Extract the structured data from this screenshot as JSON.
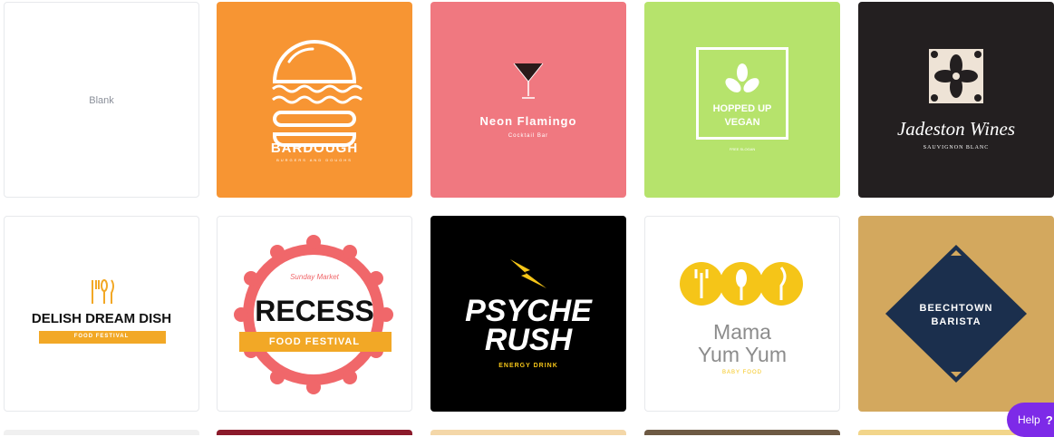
{
  "templates": {
    "blank": {
      "label": "Blank"
    },
    "bardough": {
      "title": "BARDOUGH",
      "subtitle": "BURGERS AND DOUGHS",
      "bg": "#f79533"
    },
    "neon_flamingo": {
      "title": "Neon Flamingo",
      "subtitle": "Cocktail Bar",
      "bg": "#f07880"
    },
    "hopped_up_vegan": {
      "title_line1": "HOPPED UP",
      "title_line2": "VEGAN",
      "subtitle": "FREE SLOGAN",
      "bg": "#b6e36c"
    },
    "jadeston_wines": {
      "title": "Jadeston Wines",
      "subtitle": "SAUVIGNON BLANC",
      "bg": "#231f20"
    },
    "delish": {
      "title": "DELISH DREAM DISH",
      "subtitle": "FOOD FESTIVAL",
      "accent": "#f2a826"
    },
    "recess": {
      "kicker": "Sunday Market",
      "title": "RECESS",
      "subtitle": "FOOD FESTIVAL",
      "accent": "#f0676a",
      "band": "#f2a826"
    },
    "psyche_rush": {
      "title_line1": "PSYCHE",
      "title_line2": "RUSH",
      "subtitle": "ENERGY DRINK",
      "bg": "#000000",
      "accent": "#f5c518"
    },
    "mama_yum_yum": {
      "title_line1": "Mama",
      "title_line2": "Yum Yum",
      "subtitle": "BABY FOOD",
      "accent": "#f5c518"
    },
    "beechtown": {
      "title_line1": "BEECHTOWN",
      "title_line2": "BARISTA",
      "bg": "#d3a85e",
      "diamond": "#1b2f4d"
    }
  },
  "help": {
    "label": "Help",
    "icon": "?"
  }
}
